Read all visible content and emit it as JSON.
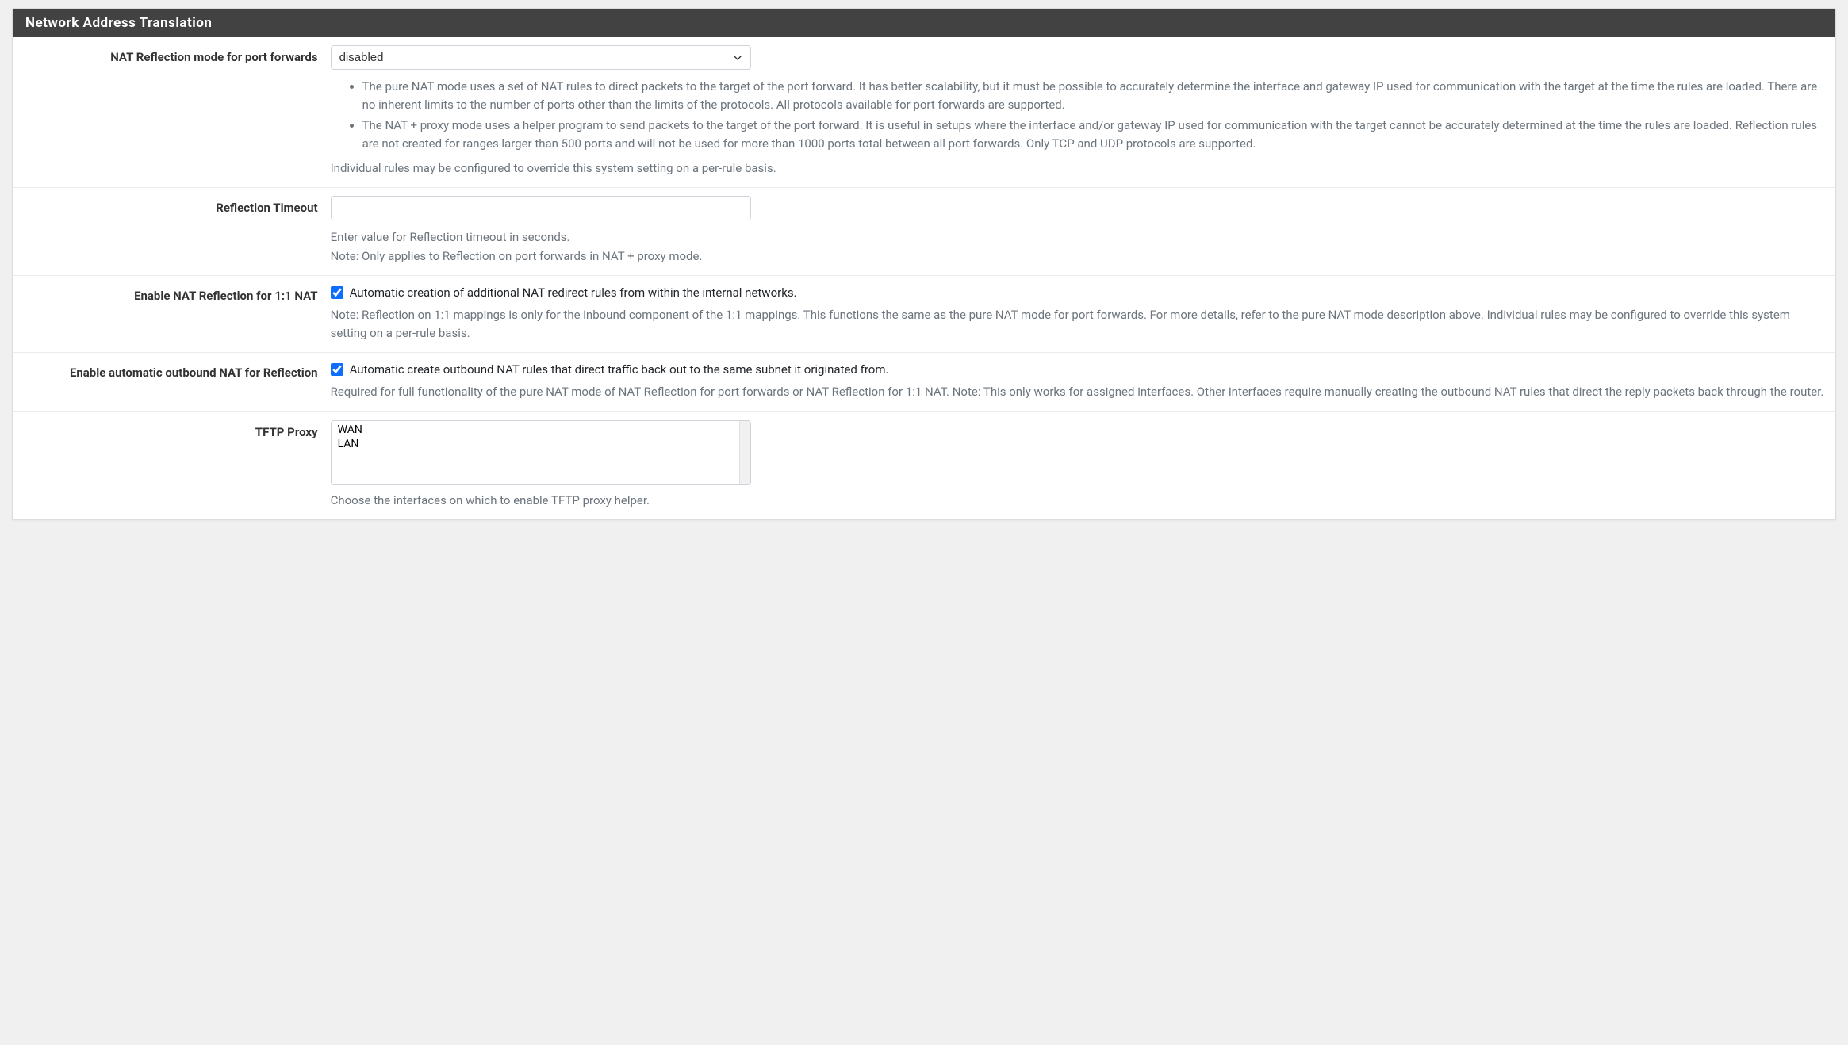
{
  "panel": {
    "title": "Network Address Translation"
  },
  "natReflectionMode": {
    "label": "NAT Reflection mode for port forwards",
    "selected": "disabled",
    "bullet1": "The pure NAT mode uses a set of NAT rules to direct packets to the target of the port forward. It has better scalability, but it must be possible to accurately determine the interface and gateway IP used for communication with the target at the time the rules are loaded. There are no inherent limits to the number of ports other than the limits of the protocols. All protocols available for port forwards are supported.",
    "bullet2": "The NAT + proxy mode uses a helper program to send packets to the target of the port forward. It is useful in setups where the interface and/or gateway IP used for communication with the target cannot be accurately determined at the time the rules are loaded. Reflection rules are not created for ranges larger than 500 ports and will not be used for more than 1000 ports total between all port forwards. Only TCP and UDP protocols are supported.",
    "footer": "Individual rules may be configured to override this system setting on a per-rule basis."
  },
  "reflectionTimeout": {
    "label": "Reflection Timeout",
    "value": "",
    "help1": "Enter value for Reflection timeout in seconds.",
    "help2": "Note: Only applies to Reflection on port forwards in NAT + proxy mode."
  },
  "enableNat11": {
    "label": "Enable NAT Reflection for 1:1 NAT",
    "checkboxLabel": "Automatic creation of additional NAT redirect rules from within the internal networks.",
    "help": "Note: Reflection on 1:1 mappings is only for the inbound component of the 1:1 mappings. This functions the same as the pure NAT mode for port forwards. For more details, refer to the pure NAT mode description above. Individual rules may be configured to override this system setting on a per-rule basis."
  },
  "enableAutoOutbound": {
    "label": "Enable automatic outbound NAT for Reflection",
    "checkboxLabel": "Automatic create outbound NAT rules that direct traffic back out to the same subnet it originated from.",
    "help": "Required for full functionality of the pure NAT mode of NAT Reflection for port forwards or NAT Reflection for 1:1 NAT. Note: This only works for assigned interfaces. Other interfaces require manually creating the outbound NAT rules that direct the reply packets back through the router."
  },
  "tftpProxy": {
    "label": "TFTP Proxy",
    "options": [
      "WAN",
      "LAN"
    ],
    "help": "Choose the interfaces on which to enable TFTP proxy helper."
  }
}
